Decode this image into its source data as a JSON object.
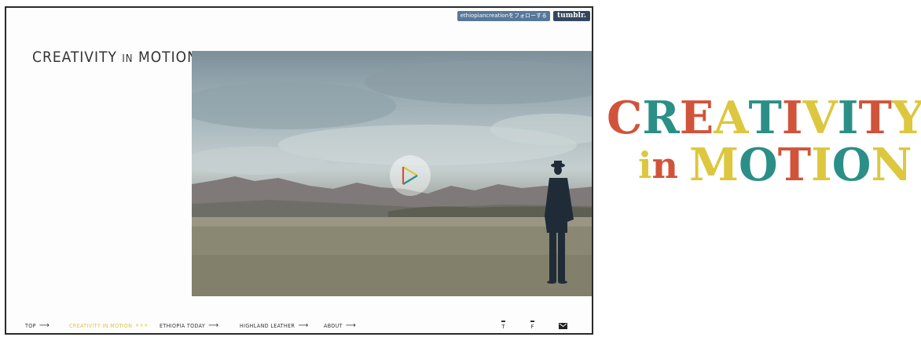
{
  "tumblr_bar": {
    "follow_label": "ethiopiancreationをフォローする",
    "brand": "tumblr."
  },
  "site": {
    "title_main_a": "CREATIVITY ",
    "title_small": "IN",
    "title_main_b": " MOTION"
  },
  "hero": {
    "play_icon": "play-triangle-icon"
  },
  "nav": {
    "items": [
      {
        "label": "TOP",
        "arrow": "⟶"
      },
      {
        "label": "CREATIVITY IN MOTION",
        "arrow": "✕✕✕",
        "active": true
      },
      {
        "label": "ETHIOPIA TODAY",
        "arrow": "⟶"
      },
      {
        "label": "HIGHLAND LEATHER",
        "arrow": "⟶"
      },
      {
        "label": "ABOUT",
        "arrow": "⟶"
      }
    ],
    "social": {
      "t": "T",
      "f": "F",
      "mail_icon": "envelope-icon"
    }
  },
  "logo": {
    "line1": [
      "C",
      "R",
      "E",
      "A",
      "T",
      "I",
      "V",
      "I",
      "T",
      "Y"
    ],
    "line2_small": [
      "i",
      "n"
    ],
    "line2": [
      "M",
      "O",
      "T",
      "I",
      "O",
      "N"
    ],
    "colors": {
      "red": "#d1533a",
      "teal": "#2b8f88",
      "yellow": "#dcc73e"
    }
  }
}
